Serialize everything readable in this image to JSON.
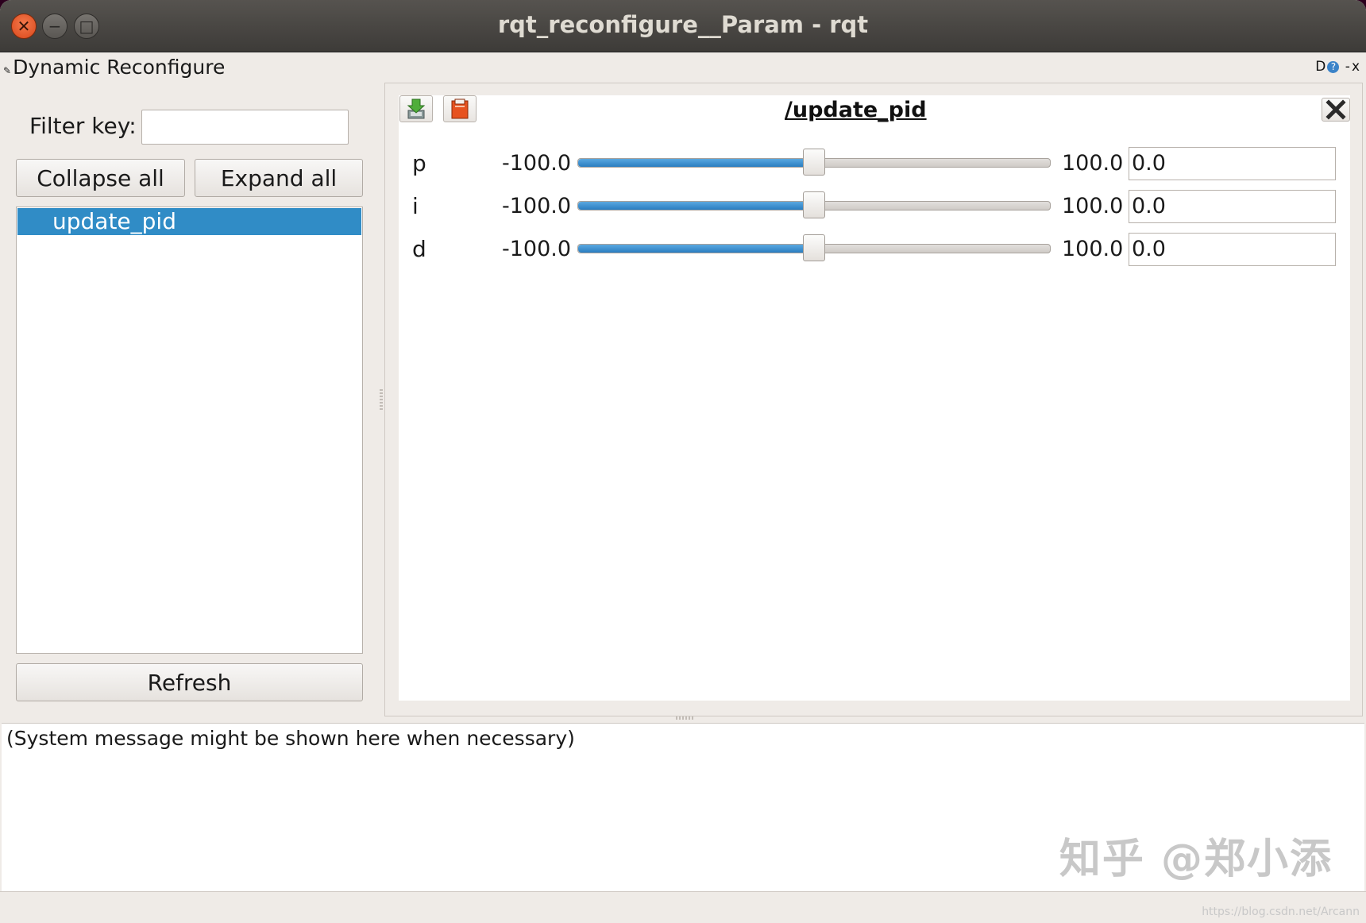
{
  "window": {
    "title": "rqt_reconfigure__Param - rqt"
  },
  "dock": {
    "title": "Dynamic Reconfigure",
    "controls": "D",
    "help": "?",
    "float": "-",
    "close": "x"
  },
  "left": {
    "filter_label": "Filter key:",
    "filter_value": "",
    "collapse_label": "Collapse all",
    "expand_label": "Expand all",
    "tree_items": [
      "update_pid"
    ],
    "refresh_label": "Refresh"
  },
  "node": {
    "title": "/update_pid",
    "params": [
      {
        "name": "p",
        "min": "-100.0",
        "max": "100.0",
        "value": "0.0",
        "level": 0.5
      },
      {
        "name": "i",
        "min": "-100.0",
        "max": "100.0",
        "value": "0.0",
        "level": 0.5
      },
      {
        "name": "d",
        "min": "-100.0",
        "max": "100.0",
        "value": "0.0",
        "level": 0.5
      }
    ]
  },
  "console": {
    "message": "(System message might be shown here when necessary)"
  },
  "watermark": {
    "text": "知乎 @郑小添",
    "url": "https://blog.csdn.net/Arcann"
  },
  "colors": {
    "selection": "#308cc6",
    "slider_fill": "#2a7dc0",
    "close_button": "#e6521f"
  }
}
